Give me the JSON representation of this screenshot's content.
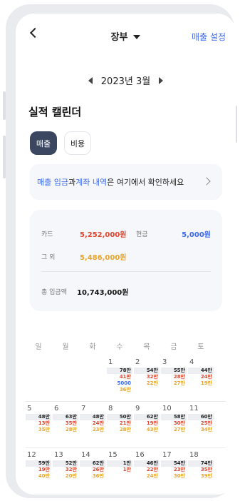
{
  "header": {
    "title": "장부",
    "settings_label": "매출 설정"
  },
  "month": {
    "label": "2023년 3월"
  },
  "section_title": "실적 캘린더",
  "tabs": [
    {
      "label": "매출",
      "active": true
    },
    {
      "label": "비용",
      "active": false
    }
  ],
  "banner": {
    "hl1": "매출 입금",
    "t1": "과 ",
    "hl2": "계좌 내역",
    "t2": "은 여기에서 확인하세요"
  },
  "summary": {
    "card_label": "카드",
    "card_value": "5,252,000원",
    "cash_label": "현금",
    "cash_value": "5,000원",
    "other_label": "그 외",
    "other_value": "5,486,000원",
    "total_label": "총 입금액",
    "total_value": "10,743,000원"
  },
  "colors": {
    "accent": "#3d6bf0",
    "card": "#e0452e",
    "other": "#e9a52b",
    "tab_active": "#3b4660"
  },
  "calendar": {
    "weekdays": [
      "일",
      "월",
      "화",
      "수",
      "목",
      "금",
      "토"
    ],
    "weeks": [
      [
        null,
        null,
        null,
        {
          "day": "1",
          "total": "78만",
          "card": "41만",
          "cash": "5000",
          "other": "36만"
        },
        {
          "day": "2",
          "total": "54만",
          "card": "32만",
          "other": "22만"
        },
        {
          "day": "3",
          "total": "55만",
          "card": "28만",
          "other": "27만"
        },
        {
          "day": "4",
          "total": "44만",
          "card": "24만",
          "other": "19만"
        }
      ],
      [
        {
          "day": "5",
          "total": "48만",
          "card": "13만",
          "other": "35만"
        },
        {
          "day": "6",
          "total": "63만",
          "card": "35만",
          "other": "28만"
        },
        {
          "day": "7",
          "total": "48만",
          "card": "24만",
          "other": "23만"
        },
        {
          "day": "8",
          "total": "50만",
          "card": "21만",
          "other": "28만"
        },
        {
          "day": "9",
          "total": "62만",
          "card": "19만",
          "other": "43만"
        },
        {
          "day": "10",
          "total": "58만",
          "card": "30만",
          "other": "27만"
        },
        {
          "day": "11",
          "total": "60만",
          "card": "25만",
          "other": "34만"
        }
      ],
      [
        {
          "day": "12",
          "total": "59만",
          "card": "19만",
          "other": "40만"
        },
        {
          "day": "13",
          "total": "52만",
          "card": "32만",
          "other": "20만"
        },
        {
          "day": "14",
          "total": "62만",
          "card": "26만",
          "other": "36만"
        },
        {
          "day": "15",
          "total": "1만",
          "card": "1만"
        },
        {
          "day": "16",
          "total": "46만",
          "card": "22만",
          "other": "24만"
        },
        {
          "day": "17",
          "total": "54만",
          "card": "23만",
          "other": "30만"
        },
        {
          "day": "18",
          "total": "74만",
          "card": "35만",
          "other": "39만"
        }
      ]
    ]
  }
}
